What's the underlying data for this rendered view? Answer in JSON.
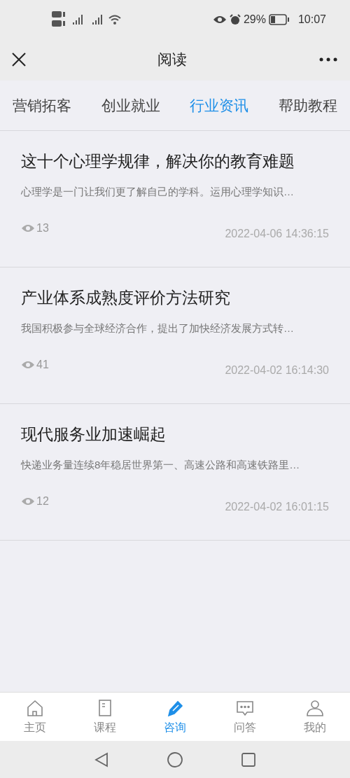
{
  "status_bar": {
    "battery": "29%",
    "time": "10:07"
  },
  "header": {
    "title": "阅读"
  },
  "tabs": [
    {
      "label": "营销拓客",
      "selected": false
    },
    {
      "label": "创业就业",
      "selected": false
    },
    {
      "label": "行业资讯",
      "selected": true
    },
    {
      "label": "帮助教程",
      "selected": false
    }
  ],
  "articles": [
    {
      "title": "这十个心理学规律，解决你的教育难题",
      "summary": "心理学是一门让我们更了解自己的学科。运用心理学知识…",
      "views": "13",
      "date": "2022-04-06 14:36:15"
    },
    {
      "title": "产业体系成熟度评价方法研究",
      "summary": "我国积极参与全球经济合作，提出了加快经济发展方式转…",
      "views": "41",
      "date": "2022-04-02 16:14:30"
    },
    {
      "title": "现代服务业加速崛起",
      "summary": "快递业务量连续8年稳居世界第一、高速公路和高速铁路里…",
      "views": "12",
      "date": "2022-04-02 16:01:15"
    }
  ],
  "bottom_nav": [
    {
      "kind": "home",
      "label": "主页",
      "selected": false
    },
    {
      "kind": "course",
      "label": "课程",
      "selected": false
    },
    {
      "kind": "consult",
      "label": "咨询",
      "selected": true
    },
    {
      "kind": "qa",
      "label": "问答",
      "selected": false
    },
    {
      "kind": "me",
      "label": "我的",
      "selected": false
    }
  ]
}
